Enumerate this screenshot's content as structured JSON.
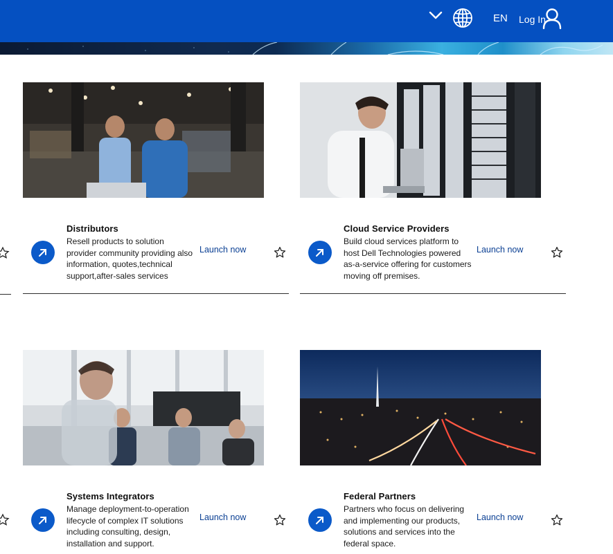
{
  "header": {
    "language": "EN",
    "login_label": "Log In",
    "icons": [
      "chevron-down-icon",
      "globe-icon",
      "user-icon"
    ],
    "brand_color": "#0550c1"
  },
  "cards": [
    {
      "title": "Distributors",
      "description": "Resell products to solution provider community providing also information, quotes,technical support,after-sales services",
      "launch_label": "Launch now"
    },
    {
      "title": "Cloud Service Providers",
      "description": "Build cloud services platform to host Dell Technologies powered as-a-service offering for customers moving off premises.",
      "launch_label": "Launch now"
    },
    {
      "title": "Systems Integrators",
      "description": "Manage deployment-to-operation lifecycle of complex IT solutions including consulting, design, installation and support.",
      "launch_label": "Launch now"
    },
    {
      "title": "Federal Partners",
      "description": "Partners who focus on delivering and implementing our products, solutions and services into the federal space.",
      "launch_label": "Launch now"
    }
  ],
  "colors": {
    "action_blue": "#0b5ac9",
    "link_blue": "#0a3f93"
  }
}
